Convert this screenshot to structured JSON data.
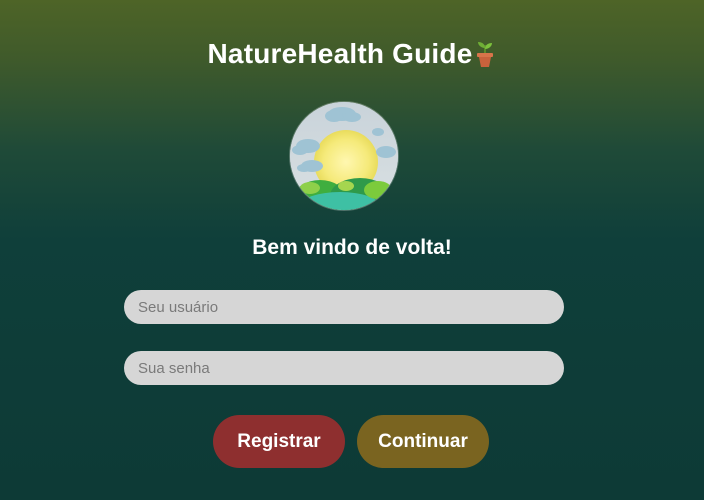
{
  "header": {
    "title": "NatureHealth Guide",
    "title_icon": "potted-plant-icon"
  },
  "logo": {
    "icon": "sun-clouds-hills-logo"
  },
  "welcome": {
    "text": "Bem vindo de volta!"
  },
  "form": {
    "username_placeholder": "Seu usuário",
    "username_value": "",
    "password_placeholder": "Sua senha",
    "password_value": ""
  },
  "buttons": {
    "register_label": "Registrar",
    "continue_label": "Continuar"
  },
  "colors": {
    "background_top": "#4e6427",
    "background_bottom": "#0d3a36",
    "register_button": "#8e2f2f",
    "continue_button": "#7a6420",
    "input_background": "#d6d6d6"
  }
}
